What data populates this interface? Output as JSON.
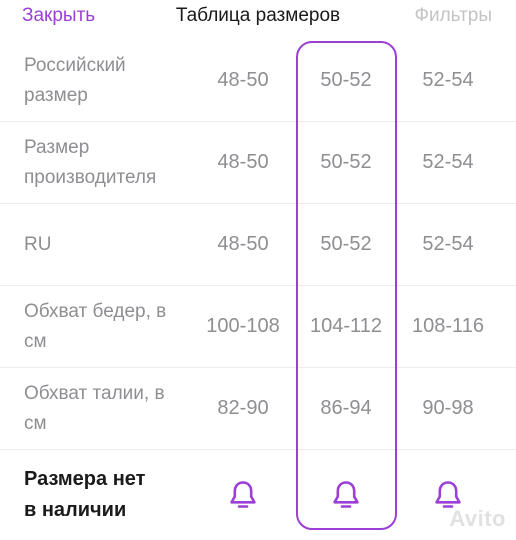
{
  "header": {
    "close_label": "Закрыть",
    "title": "Таблица размеров",
    "filters_label": "Фильтры"
  },
  "rows": [
    {
      "label_line1": "Российский",
      "label_line2": "размер",
      "values": [
        "48-50",
        "50-52",
        "52-54"
      ]
    },
    {
      "label_line1": "Размер",
      "label_line2": "производителя",
      "values": [
        "48-50",
        "50-52",
        "52-54"
      ]
    },
    {
      "label_line1": "RU",
      "label_line2": "",
      "values": [
        "48-50",
        "50-52",
        "52-54"
      ]
    },
    {
      "label_line1": "Обхват бедер, в",
      "label_line2": "см",
      "values": [
        "100-108",
        "104-112",
        "108-116"
      ]
    },
    {
      "label_line1": "Обхват талии, в",
      "label_line2": "см",
      "values": [
        "82-90",
        "86-94",
        "90-98"
      ]
    }
  ],
  "availability": {
    "label_line1": "Размера нет",
    "label_line2": "в наличии",
    "icons": [
      "bell-icon",
      "bell-icon",
      "bell-icon"
    ]
  },
  "selected_column": 1,
  "colors": {
    "accent": "#9b3fd6",
    "text": "#8e8e93",
    "title": "#1a1a1a",
    "disabled": "#c4c4c6"
  },
  "watermark": "Avito"
}
